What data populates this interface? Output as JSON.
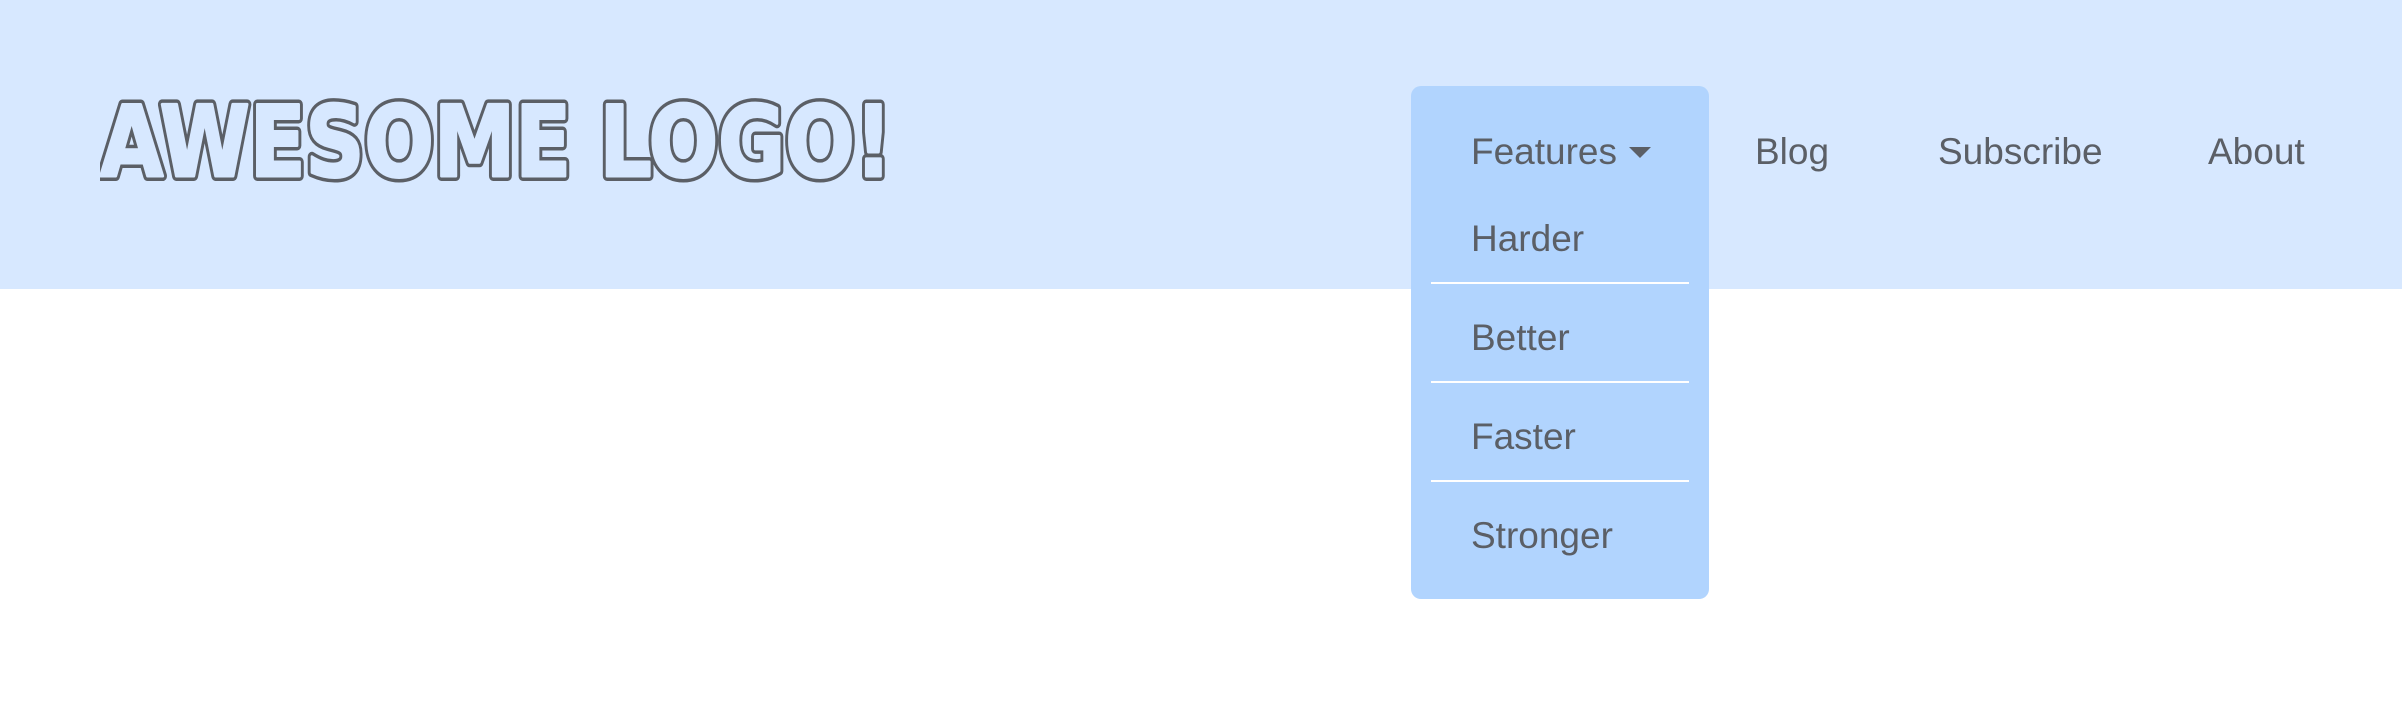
{
  "header": {
    "logo_text": "AWESOME LOGO!",
    "background_color": "#d7e8ff"
  },
  "nav": {
    "features": {
      "label": "Features",
      "icon": "caret-down-icon",
      "expanded": true,
      "dropdown_color": "#b1d4fe",
      "items": [
        {
          "label": "Harder"
        },
        {
          "label": "Better"
        },
        {
          "label": "Faster"
        },
        {
          "label": "Stronger"
        }
      ]
    },
    "blog": {
      "label": "Blog"
    },
    "subscribe": {
      "label": "Subscribe"
    },
    "about": {
      "label": "About"
    }
  },
  "colors": {
    "text": "#5b5f66",
    "page_background": "#ffffff"
  }
}
